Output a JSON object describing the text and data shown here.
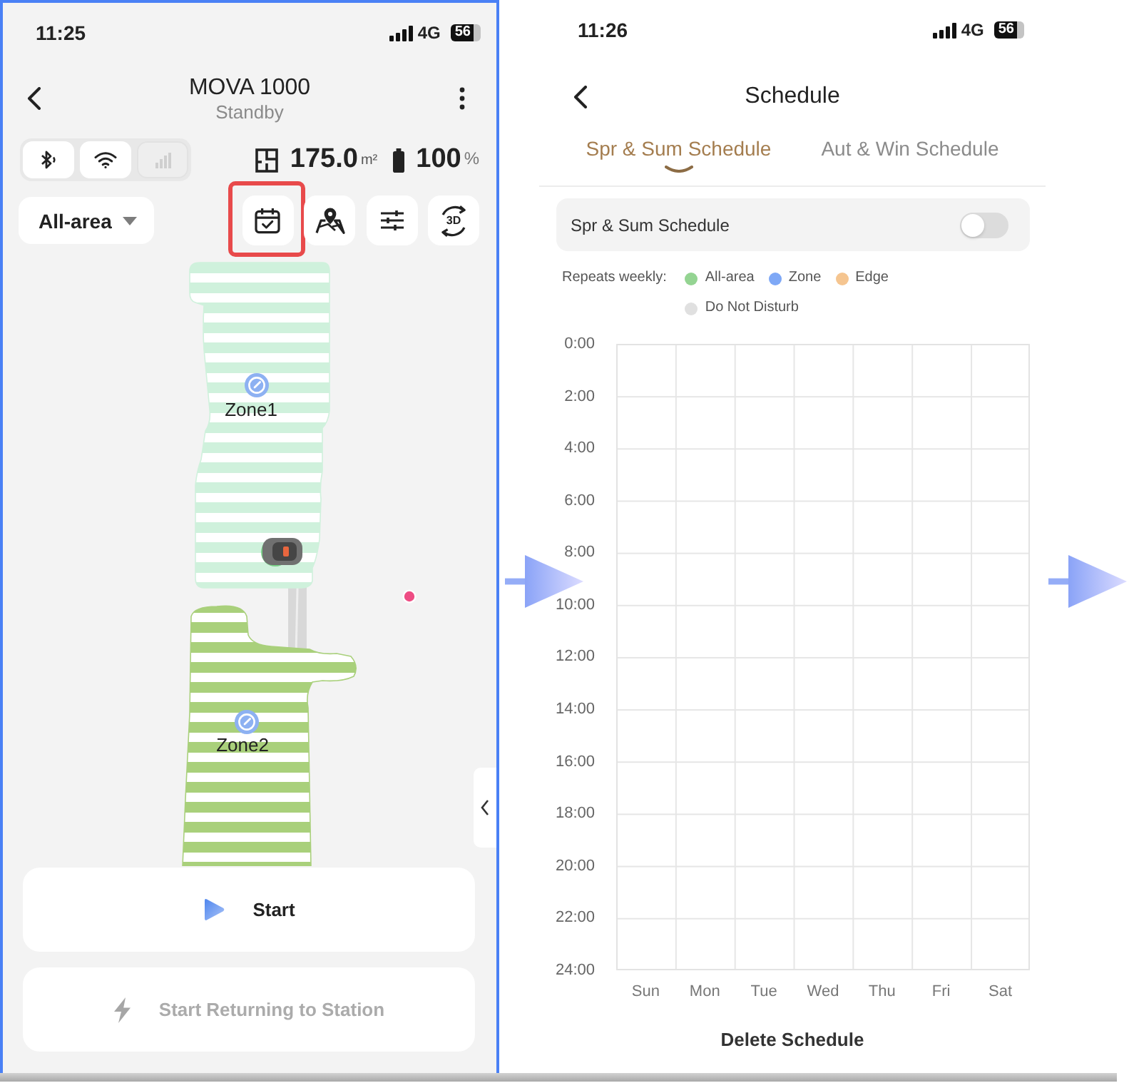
{
  "left_screen": {
    "status_bar": {
      "time": "11:25",
      "network": "4G",
      "battery": "56"
    },
    "header": {
      "title": "MOVA 1000",
      "subtitle": "Standby"
    },
    "connectivity": [
      {
        "kind": "bluetooth",
        "disabled": false
      },
      {
        "kind": "wifi",
        "disabled": false
      },
      {
        "kind": "cellular",
        "disabled": true
      }
    ],
    "stats": {
      "area": "175.0",
      "area_unit": "m²",
      "battery": "100",
      "battery_unit": "%"
    },
    "area_selector": {
      "value": "All-area"
    },
    "toolbar": [
      {
        "kind": "schedule",
        "highlighted": true
      },
      {
        "kind": "map",
        "highlighted": false
      },
      {
        "kind": "settings",
        "highlighted": false
      },
      {
        "kind": "view_3d",
        "label": "3D",
        "highlighted": false
      }
    ],
    "map": {
      "zones": [
        {
          "label": "Zone1",
          "color": "#cff1dc"
        },
        {
          "label": "Zone2",
          "color": "#a9d07b"
        }
      ]
    },
    "actions": [
      {
        "kind": "start",
        "label": "Start",
        "disabled": false
      },
      {
        "kind": "return",
        "label": "Start Returning to Station",
        "disabled": true
      }
    ]
  },
  "right_screen": {
    "status_bar": {
      "time": "11:26",
      "network": "4G",
      "battery": "56"
    },
    "header": {
      "title": "Schedule"
    },
    "tabs": [
      {
        "label": "Spr & Sum Schedule",
        "selected": true
      },
      {
        "label": "Aut & Win Schedule",
        "selected": false
      }
    ],
    "season_toggle": {
      "label": "Spr & Sum Schedule",
      "on": false
    },
    "legend": {
      "label": "Repeats weekly:",
      "items": [
        {
          "label": "All-area",
          "color": "#94d492"
        },
        {
          "label": "Zone",
          "color": "#7ea8f6"
        },
        {
          "label": "Edge",
          "color": "#f5c590"
        },
        {
          "label": "Do Not Disturb",
          "color": "#e0e0e0"
        }
      ]
    },
    "schedule": {
      "hours": [
        "0:00",
        "2:00",
        "4:00",
        "6:00",
        "8:00",
        "10:00",
        "12:00",
        "14:00",
        "16:00",
        "18:00",
        "20:00",
        "22:00",
        "24:00"
      ],
      "days": [
        "Sun",
        "Mon",
        "Tue",
        "Wed",
        "Thu",
        "Fri",
        "Sat"
      ]
    },
    "delete_button": {
      "label": "Delete Schedule"
    }
  }
}
